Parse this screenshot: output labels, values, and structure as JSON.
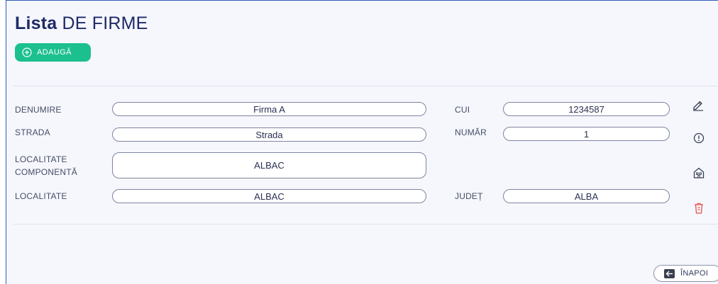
{
  "header": {
    "title_bold": "Lista",
    "title_rest": " DE FIRME",
    "add_label": "ADAUGĂ"
  },
  "form": {
    "denumire": {
      "label": "DENUMIRE",
      "value": "Firma A"
    },
    "cui": {
      "label": "CUI",
      "value": "1234587"
    },
    "strada": {
      "label": "STRADA",
      "value": "Strada"
    },
    "numar": {
      "label": "NUMĂR",
      "value": "1"
    },
    "localitate_componenta": {
      "label_line1": "LOCALITATE",
      "label_line2": "COMPONENTĂ",
      "value": "ALBAC"
    },
    "localitate": {
      "label": "LOCALITATE",
      "value": "ALBAC"
    },
    "judet": {
      "label": "JUDEȚ",
      "value": "ALBA"
    }
  },
  "actions": {
    "icons": [
      "edit-pencil-icon",
      "info-circle-icon",
      "building-icon",
      "trash-icon"
    ],
    "delete_color": "#e5534b"
  },
  "footer": {
    "back_label": "ÎNAPOI"
  },
  "colors": {
    "accent_green": "#1cc08f",
    "title_blue": "#1f2a66",
    "panel_bg": "#f5f7fd"
  }
}
